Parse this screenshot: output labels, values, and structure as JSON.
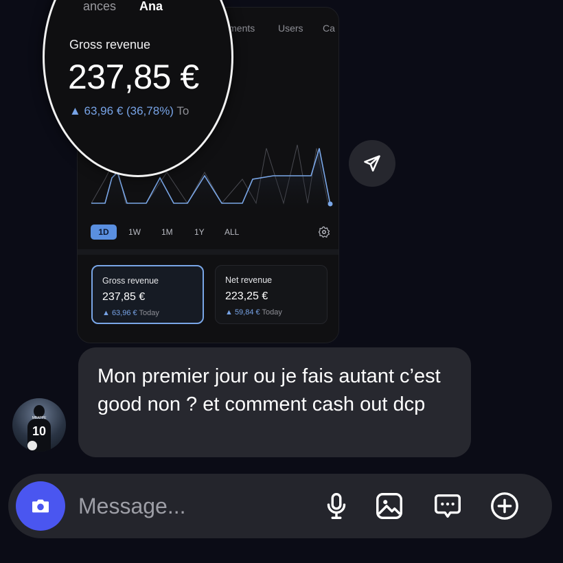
{
  "card": {
    "tabs": [
      "Payments",
      "Users",
      "Ca"
    ],
    "ranges": [
      "1D",
      "1W",
      "1M",
      "1Y",
      "ALL"
    ],
    "active_range": "1D",
    "stats": [
      {
        "label": "Gross revenue",
        "value": "237,85 €",
        "change": "▲ 63,96 €",
        "period": "Today"
      },
      {
        "label": "Net revenue",
        "value": "223,25 €",
        "change": "▲ 59,84 €",
        "period": "Today"
      }
    ]
  },
  "magnifier": {
    "tabs_partial": [
      "ances",
      "Ana"
    ],
    "label": "Gross revenue",
    "amount": "237,85 €",
    "change": "▲ 63,96 € (36,78%)",
    "period": "To"
  },
  "message": {
    "text": "Mon premier jour ou je fais autant c’est good non ? et comment cash out dcp"
  },
  "avatar": {
    "name": "MBAPPE",
    "number": "10"
  },
  "composer": {
    "placeholder": "Message..."
  },
  "colors": {
    "background": "#0b0c16",
    "bubble": "#27282f",
    "accent_blue": "#7aa7e8",
    "camera_button": "#4a56f0"
  },
  "icons": [
    "send-icon",
    "settings-icon",
    "camera-icon",
    "microphone-icon",
    "gallery-icon",
    "sticker-icon",
    "add-icon"
  ]
}
